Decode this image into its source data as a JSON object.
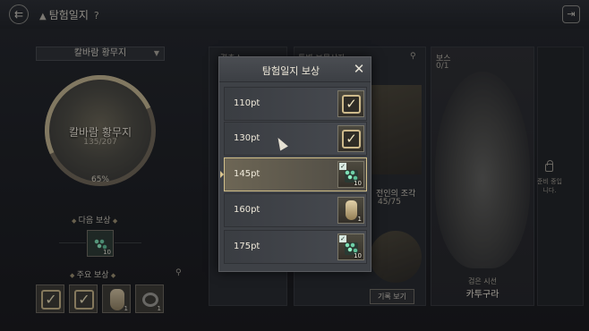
{
  "header": {
    "title": "탐험일지",
    "help": "?",
    "back_icon": "back-arrow-icon",
    "exit_icon": "exit-icon"
  },
  "region": {
    "selector": "칼바람 황무지",
    "name": "칼바람 황무지",
    "progress": "135/207",
    "percent": "65%"
  },
  "next_reward": {
    "label": "다음 보상",
    "quantity": "10"
  },
  "key_rewards": {
    "label": "주요 보상",
    "items": [
      {
        "icon": "check-icon",
        "quantity": ""
      },
      {
        "icon": "check-icon",
        "quantity": ""
      },
      {
        "icon": "mask-icon",
        "quantity": "1"
      },
      {
        "icon": "ring-icon",
        "quantity": "1"
      }
    ]
  },
  "columns": {
    "col1_head": "결축소",
    "col2_head": "특별 보물상자",
    "piece_label": "전인의 조각",
    "piece_count": "45/75",
    "record_button": "기록 보기"
  },
  "boss": {
    "head": "보스",
    "count": "0/1",
    "subtitle": "검은 시선",
    "name": "카투구라"
  },
  "locked": {
    "text": "준비 중입니다."
  },
  "modal": {
    "title": "탐험일지 보상",
    "close_icon": "close-icon",
    "rows": [
      {
        "points": "110pt",
        "reward": "check",
        "quantity": "",
        "selected": false
      },
      {
        "points": "130pt",
        "reward": "check",
        "quantity": "",
        "selected": false
      },
      {
        "points": "145pt",
        "reward": "gem-pack",
        "quantity": "10",
        "selected": true
      },
      {
        "points": "160pt",
        "reward": "mask",
        "quantity": "1",
        "selected": false
      },
      {
        "points": "175pt",
        "reward": "gem-pack",
        "quantity": "10",
        "selected": false
      }
    ]
  },
  "colors": {
    "accent_gold": "#d1bf8a",
    "panel": "#3e4146",
    "background": "#1a1c20"
  }
}
